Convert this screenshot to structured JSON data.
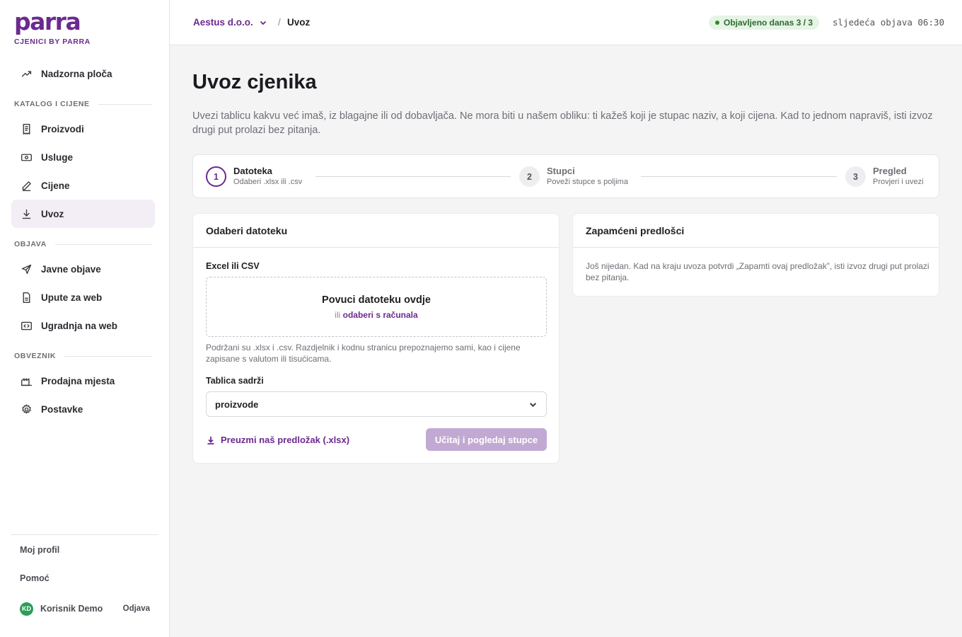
{
  "brand": {
    "logo": "parra",
    "subtitle": "CJENICI BY PARRA",
    "color": "#6b2a8f"
  },
  "sidebar": {
    "top_item": {
      "label": "Nadzorna ploča",
      "icon": "trend-icon"
    },
    "sections": [
      {
        "label": "KATALOG I CIJENE",
        "items": [
          {
            "label": "Proizvodi",
            "icon": "receipt-icon"
          },
          {
            "label": "Usluge",
            "icon": "cash-icon"
          },
          {
            "label": "Cijene",
            "icon": "pencil-icon"
          },
          {
            "label": "Uvoz",
            "icon": "download-icon",
            "active": true
          }
        ]
      },
      {
        "label": "OBJAVA",
        "items": [
          {
            "label": "Javne objave",
            "icon": "send-icon"
          },
          {
            "label": "Upute za web",
            "icon": "file-icon"
          },
          {
            "label": "Ugradnja na web",
            "icon": "code-icon"
          }
        ]
      },
      {
        "label": "OBVEZNIK",
        "items": [
          {
            "label": "Prodajna mjesta",
            "icon": "factory-icon"
          },
          {
            "label": "Postavke",
            "icon": "gear-icon"
          }
        ]
      }
    ],
    "footer": {
      "profile": "Moj profil",
      "help": "Pomoć",
      "user": {
        "initials": "KD",
        "name": "Korisnik Demo",
        "logout": "Odjava"
      }
    }
  },
  "topbar": {
    "org": "Aestus d.o.o.",
    "separator": "/",
    "current": "Uvoz",
    "status": "Objavljeno danas 3 / 3",
    "next_publish": "sljedeća objava 06:30"
  },
  "main": {
    "title": "Uvoz cjenika",
    "description": "Uvezi tablicu kakvu već imaš, iz blagajne ili od dobavljača. Ne mora biti u našem obliku: ti kažeš koji je stupac naziv, a koji cijena. Kad to jednom napraviš, isti izvoz drugi put prolazi bez pitanja.",
    "steps": [
      {
        "num": "1",
        "title": "Datoteka",
        "sub": "Odaberi .xlsx ili .csv",
        "active": true
      },
      {
        "num": "2",
        "title": "Stupci",
        "sub": "Poveži stupce s poljima"
      },
      {
        "num": "3",
        "title": "Pregled",
        "sub": "Provjeri i uvezi"
      }
    ],
    "file_card": {
      "title": "Odaberi datoteku",
      "field_label": "Excel ili CSV",
      "dropzone_title": "Povuci datoteku ovdje",
      "dropzone_or": "ili",
      "dropzone_link": "odaberi s računala",
      "hint": "Podržani su .xlsx i .csv. Razdjelnik i kodnu stranicu prepoznajemo sami, kao i cijene zapisane s valutom ili tisućicama.",
      "contains_label": "Tablica sadrži",
      "contains_value": "proizvode",
      "template_link": "Preuzmi naš predložak (.xlsx)",
      "submit": "Učitaj i pogledaj stupce"
    },
    "templates_card": {
      "title": "Zapamćeni predlošci",
      "empty": "Još nijedan. Kad na kraju uvoza potvrdi „Zapamti ovaj predložak”, isti izvoz drugi put prolazi bez pitanja."
    }
  }
}
